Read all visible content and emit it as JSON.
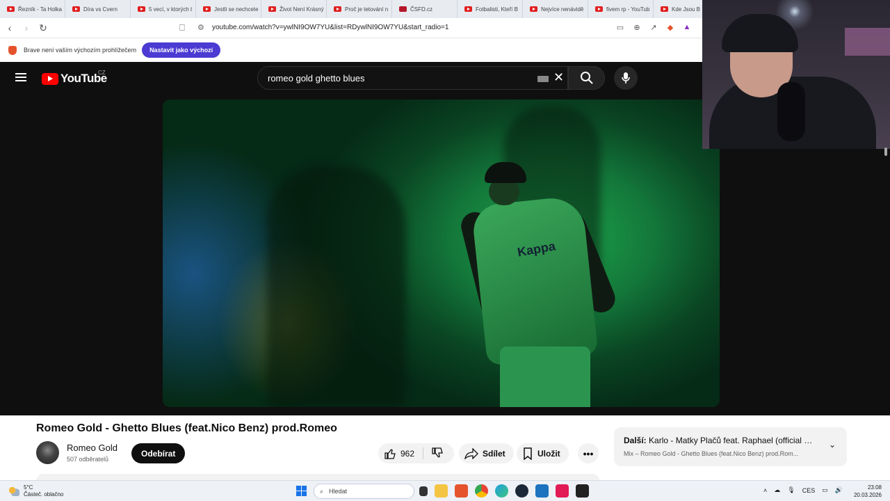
{
  "browser": {
    "tabs": [
      {
        "label": "Řezník - Ta Holka",
        "icon": "youtube-icon"
      },
      {
        "label": "Díra vs Cvern",
        "icon": "youtube-icon"
      },
      {
        "label": "5 vecí, v ktorých t",
        "icon": "youtube-icon"
      },
      {
        "label": "Jestli se nechcete",
        "icon": "youtube-icon"
      },
      {
        "label": "Život Není Krásný",
        "icon": "youtube-icon"
      },
      {
        "label": "Proč je tetování n",
        "icon": "youtube-icon"
      },
      {
        "label": "ČSFD.cz",
        "icon": "csfd-icon"
      },
      {
        "label": "Fotbalisti, Kteří B",
        "icon": "youtube-icon"
      },
      {
        "label": "Nejvíce nenávidě",
        "icon": "youtube-icon"
      },
      {
        "label": "fivem rp - YouTub",
        "icon": "youtube-icon"
      },
      {
        "label": "Kde Jsou B",
        "icon": "youtube-icon"
      }
    ],
    "url": "youtube.com/watch?v=ywlNI9OW7YU&list=RDywlNI9OW7YU&start_radio=1",
    "infobar": {
      "text": "Brave není vaším výchozím prohlížečem",
      "button": "Nastavit jako výchozí"
    }
  },
  "youtube": {
    "logo_text": "YouTube",
    "country": "CZ",
    "search_value": "romeo gold ghetto blues",
    "video": {
      "title": "Romeo Gold - Ghetto Blues (feat.Nico Benz) prod.Romeo",
      "channel": "Romeo Gold",
      "subscribers": "507 odběratelů",
      "subscribe_label": "Odebírat",
      "likes": "962",
      "share_label": "Sdílet",
      "save_label": "Uložit",
      "kappa_text": "Kappa"
    },
    "next": {
      "label": "Další:",
      "title": "Karlo - Matky Plačů feat. Raphael (official mu...",
      "mix": "Mix – Romeo Gold - Ghetto Blues (feat.Nico Benz) prod.Rom..."
    }
  },
  "taskbar": {
    "weather_temp": "5°C",
    "weather_desc": "Částeč. oblačno",
    "search_placeholder": "Hledat",
    "lang": "CES",
    "time": "23:08",
    "date": "20.03.2026"
  },
  "colors": {
    "youtube_red": "#ff0000",
    "brave_purple": "#4b3bd3",
    "youtube_bg": "#0f0f0f"
  }
}
